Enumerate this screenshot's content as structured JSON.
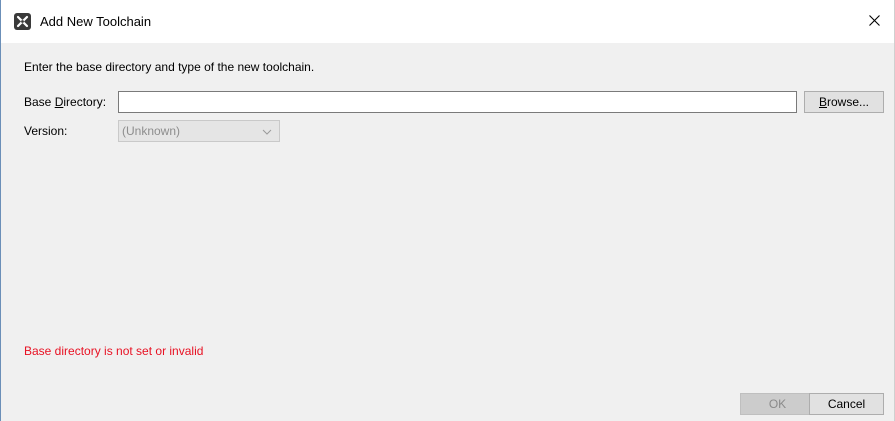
{
  "window": {
    "title": "Add New Toolchain",
    "app_icon": "app-logo-icon",
    "close_icon": "close-icon"
  },
  "form": {
    "instructions": "Enter the base directory and type of the new toolchain.",
    "base_directory": {
      "label_prefix": "Base ",
      "label_mnemonic": "D",
      "label_suffix": "irectory:",
      "value": "",
      "browse_prefix": "",
      "browse_mnemonic": "B",
      "browse_suffix": "rowse..."
    },
    "version": {
      "label": "Version:",
      "selected": "(Unknown)",
      "enabled": false
    },
    "error_message": "Base directory is not set or invalid"
  },
  "buttons": {
    "ok_label": "OK",
    "ok_enabled": false,
    "cancel_label": "Cancel"
  },
  "colors": {
    "error": "#e81123",
    "window_bg": "#f0f0f0",
    "titlebar_bg": "#ffffff"
  }
}
